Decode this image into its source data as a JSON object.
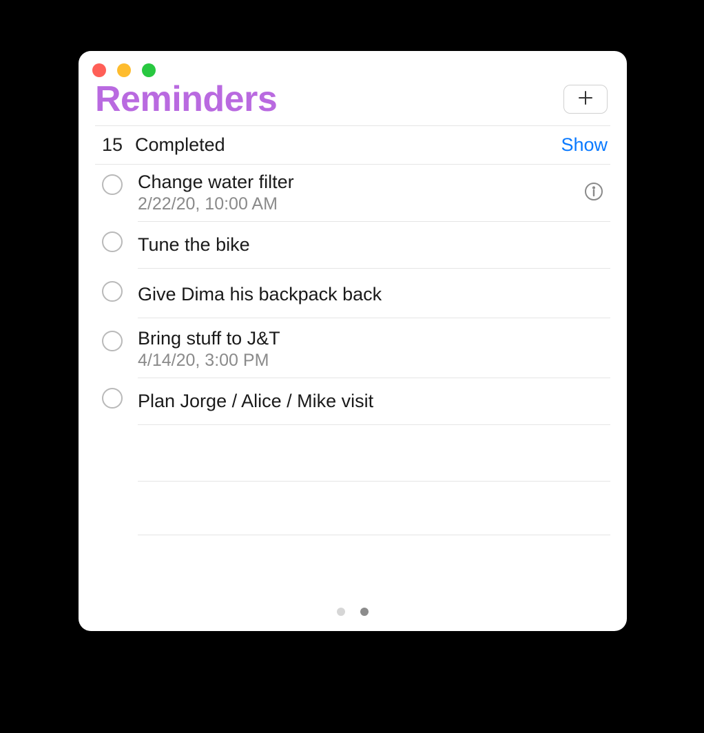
{
  "window": {
    "title": "Reminders"
  },
  "subheader": {
    "count": "15",
    "label": "Completed",
    "show": "Show"
  },
  "items": [
    {
      "title": "Change water filter",
      "date": "2/22/20, 10:00 AM",
      "has_info": true
    },
    {
      "title": "Tune the bike",
      "date": "",
      "has_info": false
    },
    {
      "title": "Give Dima his backpack back",
      "date": "",
      "has_info": false
    },
    {
      "title": "Bring stuff to J&T",
      "date": "4/14/20, 3:00 PM",
      "has_info": false
    },
    {
      "title": "Plan Jorge / Alice / Mike visit",
      "date": "",
      "has_info": false
    }
  ],
  "pager": {
    "pages": 2,
    "active_index": 1
  }
}
